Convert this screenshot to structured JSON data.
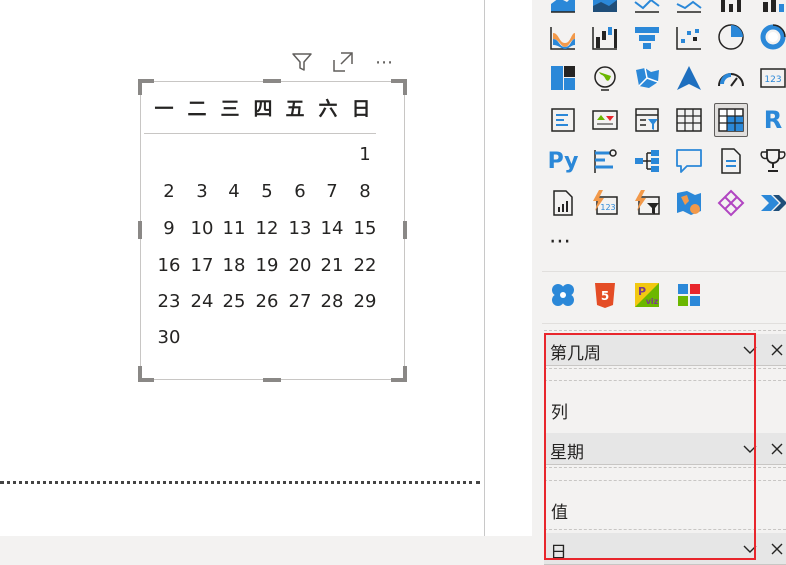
{
  "calendar": {
    "weekdays": [
      "一",
      "二",
      "三",
      "四",
      "五",
      "六",
      "日"
    ],
    "weeks": [
      [
        "",
        "",
        "",
        "",
        "",
        "",
        "1"
      ],
      [
        "2",
        "3",
        "4",
        "5",
        "6",
        "7",
        "8"
      ],
      [
        "9",
        "10",
        "11",
        "12",
        "13",
        "14",
        "15"
      ],
      [
        "16",
        "17",
        "18",
        "19",
        "20",
        "21",
        "22"
      ],
      [
        "23",
        "24",
        "25",
        "26",
        "27",
        "28",
        "29"
      ],
      [
        "30",
        "",
        "",
        "",
        "",
        "",
        ""
      ]
    ]
  },
  "visual_header": {
    "icons": [
      "filter-icon",
      "focus-mode-icon",
      "more-options-icon"
    ],
    "more_label": "⋯"
  },
  "viz_pane": {
    "more_visuals": "⋯",
    "icon_rows": [
      [
        "area-chart",
        "stacked-area-chart",
        "line-clustered-column-chart",
        "line-stacked-column-chart",
        "ribbon-chart",
        "waterfall-chart"
      ],
      [
        "ribbon-chart",
        "waterfall-chart",
        "funnel-chart",
        "scatter-chart",
        "pie-chart",
        "donut-chart"
      ],
      [
        "treemap",
        "map",
        "filled-map",
        "azure-map",
        "gauge",
        "card"
      ],
      [
        "multi-row-card",
        "kpi",
        "slicer",
        "table",
        "matrix",
        "r-visual"
      ],
      [
        "python-visual",
        "key-influencers",
        "decomposition-tree",
        "qa",
        "smart-narrative",
        "metrics"
      ],
      [
        "paginated-report",
        "power-apps",
        "power-automate",
        "arcgis-maps",
        "custom-visual",
        "more-visual"
      ]
    ],
    "custom_visuals": [
      "custom-visual-1",
      "html5-visual",
      "pbiviz-visual",
      "custom-visual-4"
    ]
  },
  "field_wells": {
    "rows_field": "第几周",
    "columns_label": "列",
    "columns_field": "星期",
    "values_label": "值",
    "values_field": "日"
  },
  "colors": {
    "accent_blue": "#2b88d8",
    "dark_blue": "#1f4e79",
    "orange": "#f2994a",
    "highlight": "#e8262c",
    "pane_bg": "#f3f2f1"
  }
}
